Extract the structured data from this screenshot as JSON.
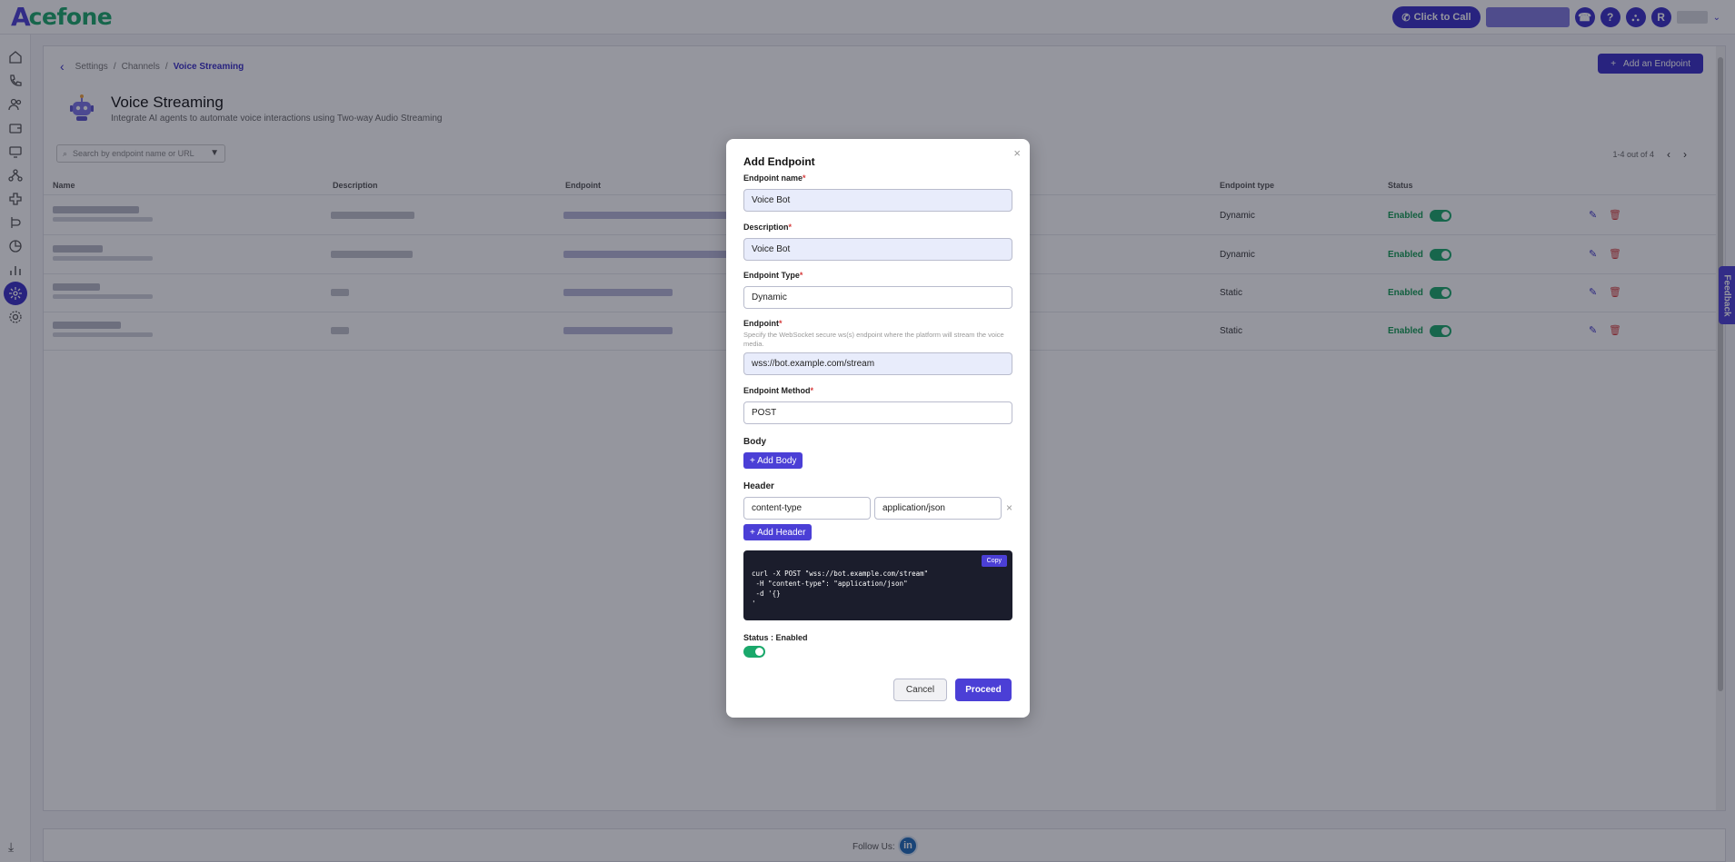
{
  "brand": {
    "logo_a": "A",
    "logo_rest": "cefone"
  },
  "topbar": {
    "click_to_call": "Click to Call",
    "avatar_initial": "R"
  },
  "breadcrumb": {
    "items": [
      "Settings",
      "Channels",
      "Voice Streaming"
    ]
  },
  "header": {
    "add_endpoint": "Add an Endpoint",
    "title": "Voice Streaming",
    "subtitle": "Integrate AI agents to automate voice interactions using Two-way Audio Streaming"
  },
  "search": {
    "placeholder": "Search by endpoint name or URL"
  },
  "pager": {
    "text": "1-4 out of 4"
  },
  "table": {
    "columns": [
      "Name",
      "Description",
      "Endpoint",
      "Endpoint type",
      "Status"
    ],
    "rows": [
      {
        "type": "Dynamic",
        "status": "Enabled"
      },
      {
        "type": "Dynamic",
        "status": "Enabled"
      },
      {
        "type": "Static",
        "status": "Enabled"
      },
      {
        "type": "Static",
        "status": "Enabled"
      }
    ]
  },
  "footer": {
    "follow": "Follow Us:",
    "linkedin": "in"
  },
  "feedback": "Feedback",
  "modal": {
    "title": "Add Endpoint",
    "name_label": "Endpoint name",
    "name_value": "Voice Bot",
    "desc_label": "Description",
    "desc_value": "Voice Bot",
    "type_label": "Endpoint Type",
    "type_value": "Dynamic",
    "endpoint_label": "Endpoint",
    "endpoint_help": "Specify the WebSocket secure ws(s) endpoint where the platform will stream the voice media.",
    "endpoint_value": "wss://bot.example.com/stream",
    "method_label": "Endpoint Method",
    "method_value": "POST",
    "body_label": "Body",
    "add_body": "+ Add Body",
    "header_label": "Header",
    "header_key": "content-type",
    "header_value": "application/json",
    "add_header": "+ Add Header",
    "copy": "Copy",
    "code": "curl -X POST \"wss://bot.example.com/stream\"\n -H \"content-type\": \"application/json\"\n -d '{}\n'",
    "status_label": "Status : Enabled",
    "cancel": "Cancel",
    "proceed": "Proceed"
  }
}
